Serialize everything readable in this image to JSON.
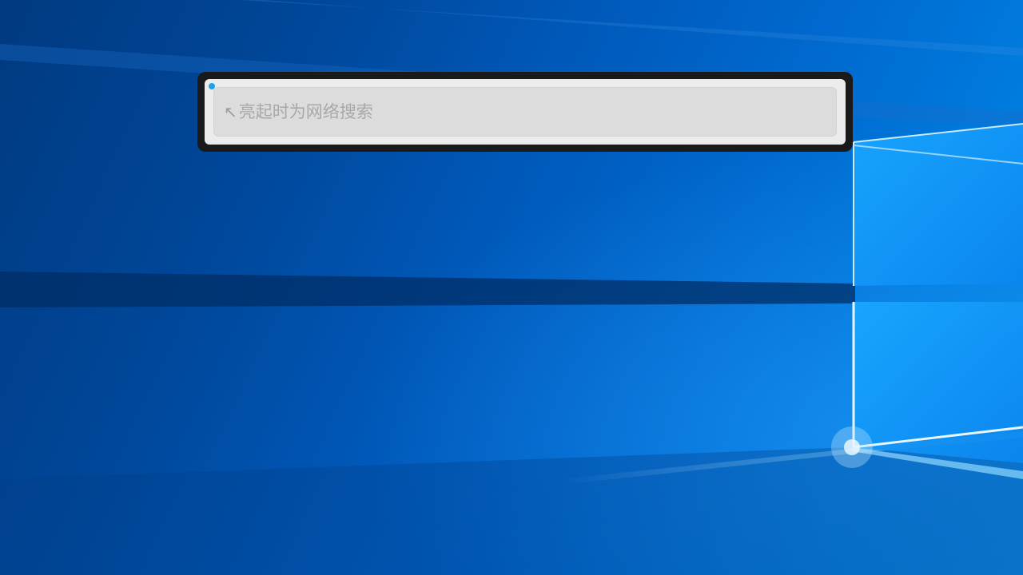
{
  "launcher": {
    "search": {
      "placeholder": "亮起时为网络搜索",
      "value": ""
    },
    "status_dot_color": "#1aa3e8"
  },
  "icons": {
    "search_hint": "arrow-up-left-icon",
    "status": "status-dot-icon"
  },
  "desktop": {
    "wallpaper": "windows-10-hero-wallpaper",
    "accent_color": "#0078d7"
  }
}
